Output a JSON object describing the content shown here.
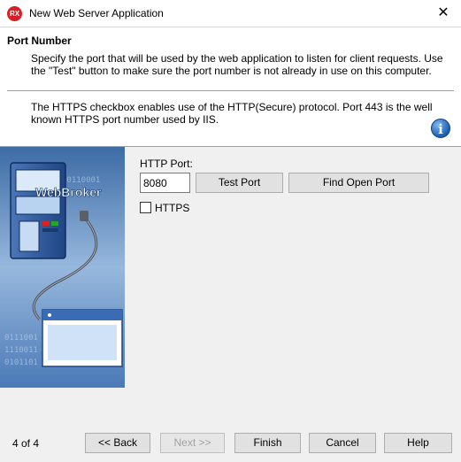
{
  "window": {
    "title": "New Web Server Application",
    "app_icon_text": "RX",
    "close_glyph": "✕"
  },
  "header": {
    "heading": "Port Number",
    "description": "Specify the port that will be used by the web application to listen for client requests.  Use the \"Test\" button to make sure the port number is not already in use on this computer.",
    "https_description": "The HTTPS checkbox enables use of the HTTP(Secure) protocol.  Port 443 is the well known HTTPS port number used by IIS.",
    "info_icon": "i"
  },
  "side_image": {
    "text": "WebBroker",
    "binary": [
      "10110001",
      "0111001",
      "1110011",
      "0101101"
    ]
  },
  "form": {
    "http_port_label": "HTTP Port:",
    "port_value": "8080",
    "test_port_label": "Test Port",
    "find_open_port_label": "Find Open Port",
    "https_label": "HTTPS",
    "https_checked": false
  },
  "footer": {
    "page_count": "4 of 4",
    "back_label": "<< Back",
    "next_label": "Next >>",
    "finish_label": "Finish",
    "cancel_label": "Cancel",
    "help_label": "Help"
  }
}
